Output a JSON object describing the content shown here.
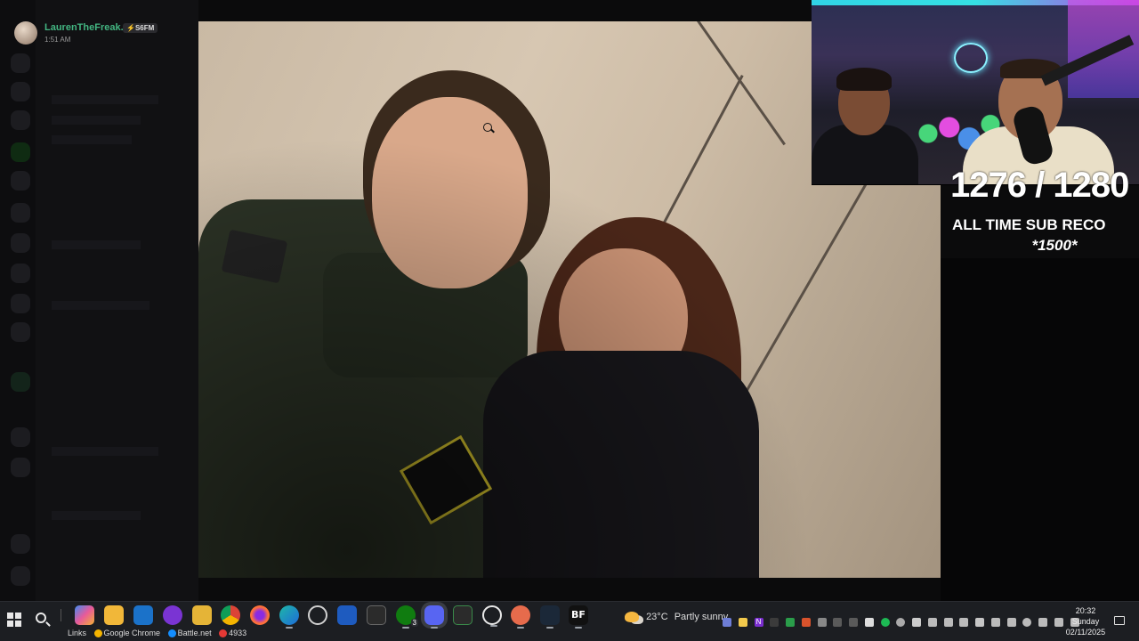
{
  "message_header": {
    "username": "LaurenTheFreak...",
    "badge": "⚡S6FM",
    "timestamp": "1:51 AM"
  },
  "stream_overlay": {
    "sub_count": "1276 / 1280",
    "record_label": "ALL TIME SUB RECO",
    "goal": "*1500*"
  },
  "taskbar": {
    "links_label": "Links",
    "chrome_label": "Google Chrome",
    "battlenet_label": "Battle.net",
    "count_label": "4933",
    "xbox_badge": "3",
    "bf_label": "BF",
    "weather_temp": "23°C",
    "weather_desc": "Partly sunny",
    "clock_time": "20:32",
    "clock_day": "Sunday",
    "clock_date": "02/11/2025",
    "tray_onenote": "N"
  },
  "colors": {
    "username": "#43b581",
    "taskbar_bg": "#1c1e22",
    "neon_cyan": "#31d4e6",
    "neon_magenta": "#c13ee5"
  },
  "icons": [
    "windows-start-icon",
    "search-icon",
    "copilot-icon",
    "store-icon",
    "outlook-icon",
    "cortana-icon",
    "file-explorer-icon",
    "chrome-icon",
    "firefox-icon",
    "edge-icon",
    "chatgpt-icon",
    "bing-icon",
    "capcut-icon",
    "xbox-icon",
    "discord-icon",
    "terminal-icon",
    "media-player-icon",
    "snipping-tool-icon",
    "steam-icon",
    "bf-icon"
  ]
}
